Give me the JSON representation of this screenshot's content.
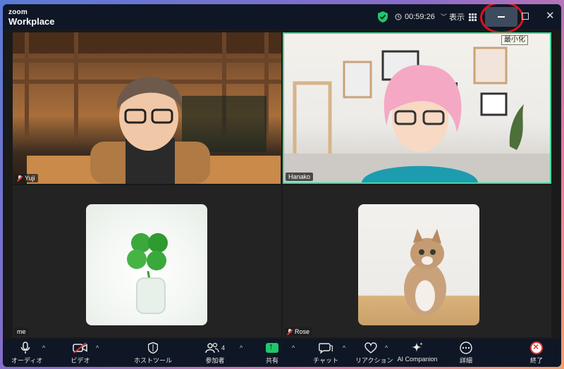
{
  "app": {
    "brand_top": "zoom",
    "brand_bottom": "Workplace"
  },
  "titlebar": {
    "timer": "00:59:26",
    "view_label": "表示",
    "minimize_tooltip": "最小化"
  },
  "participants": [
    {
      "name": "Yuji",
      "muted": true
    },
    {
      "name": "Hanako",
      "muted": false,
      "active_speaker": true
    },
    {
      "name": "me",
      "muted": false
    },
    {
      "name": "Rose",
      "muted": true
    }
  ],
  "toolbar": {
    "audio": "オーディオ",
    "video": "ビデオ",
    "host_tools": "ホストツール",
    "participants": "参加者",
    "participants_count": "4",
    "share": "共有",
    "chat": "チャット",
    "reactions": "リアクション",
    "ai_companion": "AI Companion",
    "more": "詳細",
    "end": "終了"
  },
  "colors": {
    "titlebar_bg": "#0f1726",
    "active_speaker_border": "#3fdc9a",
    "share_green": "#1fc86a",
    "end_red": "#e53935",
    "highlight_ring": "#e0101a"
  }
}
